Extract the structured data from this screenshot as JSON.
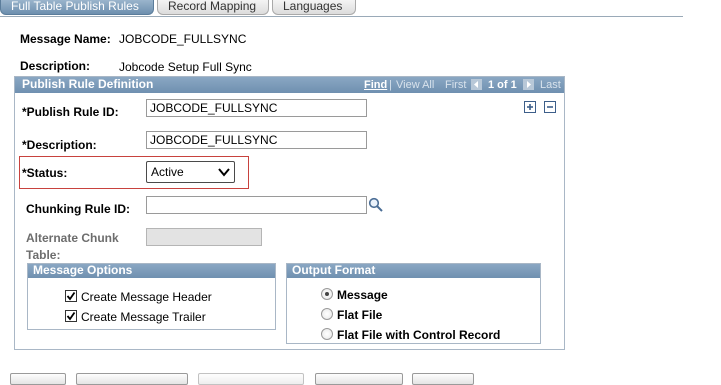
{
  "tabs": [
    {
      "label": "Full Table Publish Rules",
      "active": true
    },
    {
      "label": "Record Mapping",
      "active": false
    },
    {
      "label": "Languages",
      "active": false
    }
  ],
  "header": {
    "message_name_label": "Message Name:",
    "message_name_value": "JOBCODE_FULLSYNC",
    "description_label": "Description:",
    "description_value": "Jobcode Setup Full Sync"
  },
  "publish_rule": {
    "title": "Publish Rule Definition",
    "nav": {
      "find": "Find",
      "view_all": "View All",
      "first": "First",
      "count": "1 of 1",
      "last": "Last"
    },
    "rule_id_label": "*Publish Rule ID:",
    "rule_id_value": "JOBCODE_FULLSYNC",
    "description_label": "*Description:",
    "description_value": "JOBCODE_FULLSYNC",
    "status_label": "*Status:",
    "status_value": "Active",
    "chunking_label": "Chunking Rule ID:",
    "chunking_value": "",
    "alt_chunk_label_1": "Alternate Chunk",
    "alt_chunk_label_2": "Table:",
    "alt_chunk_value": ""
  },
  "message_options": {
    "title": "Message Options",
    "items": [
      {
        "label": "Create Message Header",
        "checked": true
      },
      {
        "label": "Create Message Trailer",
        "checked": true
      }
    ]
  },
  "output_format": {
    "title": "Output Format",
    "options": [
      {
        "label": "Message",
        "selected": true
      },
      {
        "label": "Flat File",
        "selected": false
      },
      {
        "label": "Flat File with Control Record",
        "selected": false
      }
    ]
  },
  "colors": {
    "accent": "#7396b4",
    "status_highlight": "#c8423e",
    "link": "#2b58a3"
  }
}
